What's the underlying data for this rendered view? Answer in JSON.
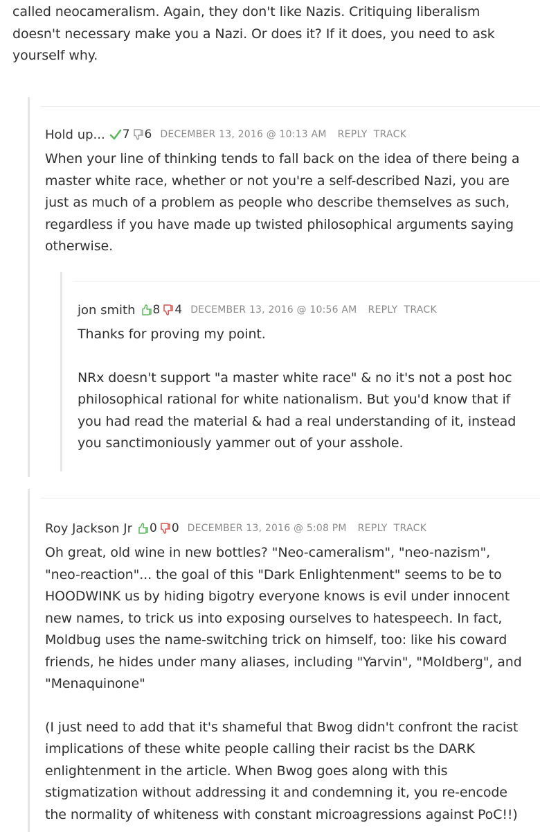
{
  "top_comment": {
    "lines": [
      "called neocameralism. Again, they don't like Nazis. Critiquing liberalism",
      "doesn't necessary make you a Nazi. Or does it? If it does, you need to ask",
      "yourself why."
    ]
  },
  "comments": [
    {
      "author": "Hold up...",
      "upvotes": "7",
      "downvotes": "6",
      "upvote_style": "check",
      "date": "DECEMBER 13, 2016 @ 10:13 AM",
      "reply_label": "REPLY",
      "track_label": "TRACK",
      "paragraphs": [
        [
          "When your line of thinking tends to fall back on the idea of there being a",
          "master white race, whether or not you're a self-described Nazi, you are",
          "just as much of a problem as people who describe themselves as such,",
          "regardless if you have made up twisted philosophical arguments saying",
          "otherwise."
        ]
      ]
    },
    {
      "author": "jon smith",
      "upvotes": "8",
      "downvotes": "4",
      "upvote_style": "thumb",
      "date": "DECEMBER 13, 2016 @ 10:56 AM",
      "reply_label": "REPLY",
      "track_label": "TRACK",
      "paragraphs": [
        [
          "Thanks for proving my point."
        ],
        [
          "NRx doesn't support \"a master white race\" & no it's not a post hoc",
          "philosophical rational for white nationalism. But you'd know that if",
          "you had read the material & had a real understanding of it, instead",
          "you sanctimoniously yammer out of your asshole."
        ]
      ]
    },
    {
      "author": "Roy Jackson Jr",
      "upvotes": "0",
      "downvotes": "0",
      "upvote_style": "thumb",
      "date": "DECEMBER 13, 2016 @ 5:08 PM",
      "reply_label": "REPLY",
      "track_label": "TRACK",
      "paragraphs": [
        [
          "Oh great, old wine in new bottles? \"Neo-cameralism\", \"neo-nazism\",",
          "\"neo-reaction\"... the goal of this \"Dark Enlightenment\" seems to be to",
          "HOODWINK us by hiding bigotry everyone knows is evil under innocent",
          "new names, to trick us into exposing ourselves to hatespeech. In fact,",
          "Moldbug uses the name-switching trick on himself, too: like his coward",
          "friends, he hides under many aliases, including \"Yarvin\", \"Moldberg\", and",
          "\"Menaquinone\""
        ],
        [
          "(I just need to add that it's shameful that Bwog didn't confront the racist",
          "implications of these white people calling their racist bs the DARK",
          "enlightenment in the article. When Bwog goes along with this",
          "stigmatization without addressing it and condemning it, you re-encode",
          "the normality of whiteness with constant microagressions against PoC!!)"
        ]
      ]
    }
  ],
  "colors": {
    "upvote_green": "#5cb85c",
    "downvote_red": "#d9534f",
    "meta_gray": "#8a8a8a",
    "guide_gray": "#e6e6e6"
  }
}
